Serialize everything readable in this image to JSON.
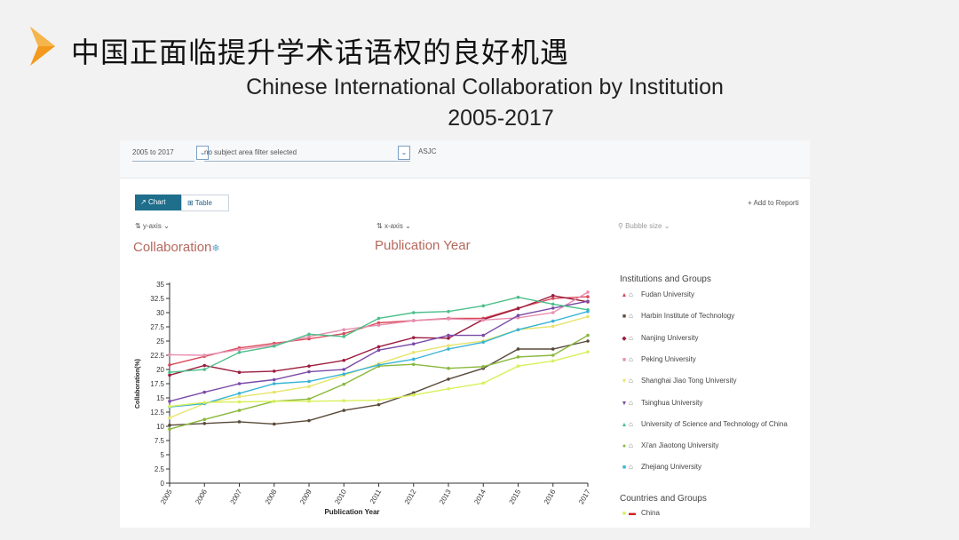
{
  "slide": {
    "title": "中国正面临提升学术话语权的良好机遇",
    "subtitle_line1": "Chinese International Collaboration by Institution",
    "subtitle_line2": "2005-2017",
    "accent_color": "#f39a1e"
  },
  "filters": {
    "year_range": "2005 to 2017",
    "subject": "no subject area filter selected",
    "classification": "ASJC"
  },
  "toolbar": {
    "chart_label": "Chart",
    "table_label": "Table",
    "add_report": "+ Add to Reporti"
  },
  "axes": {
    "y_selector": "y-axis",
    "x_selector": "x-axis",
    "bubble_selector": "Bubble size",
    "y_metric": "Collaboration",
    "x_metric": "Publication Year"
  },
  "legend": {
    "institutions_title": "Institutions and Groups",
    "countries_title": "Countries and Groups",
    "institutions": [
      {
        "name": "Fudan University",
        "color": "#d94a5a",
        "marker": "triangle"
      },
      {
        "name": "Harbin Institute of Technology",
        "color": "#5a4a3a",
        "marker": "square"
      },
      {
        "name": "Nanjing University",
        "color": "#9c1c3c",
        "marker": "diamond"
      },
      {
        "name": "Peking University",
        "color": "#e88fb0",
        "marker": "square"
      },
      {
        "name": "Shanghai Jiao Tong University",
        "color": "#e7e46a",
        "marker": "triangle-down"
      },
      {
        "name": "Tsinghua University",
        "color": "#7a4aa8",
        "marker": "triangle-down"
      },
      {
        "name": "University of Science and Technology of China",
        "color": "#4cbf8a",
        "marker": "triangle"
      },
      {
        "name": "Xi'an Jiaotong University",
        "color": "#8ab83c",
        "marker": "circle"
      },
      {
        "name": "Zhejiang University",
        "color": "#39b3d6",
        "marker": "square"
      }
    ],
    "countries": [
      {
        "name": "China",
        "color": "#d9f05a",
        "flag_color": "#d22020"
      }
    ]
  },
  "chart_data": {
    "type": "line",
    "xlabel": "Publication Year",
    "ylabel": "Collaboration(%)",
    "x": [
      2005,
      2006,
      2007,
      2008,
      2009,
      2010,
      2011,
      2012,
      2013,
      2014,
      2015,
      2016,
      2017
    ],
    "ylim": [
      0,
      35
    ],
    "yticks": [
      0,
      2.5,
      5,
      7.5,
      10,
      12.5,
      15,
      17.5,
      20,
      22.5,
      25,
      27.5,
      30,
      32.5,
      35
    ],
    "grid": false,
    "series": [
      {
        "name": "Fudan University",
        "color": "#d94a5a",
        "values": [
          20.8,
          22.3,
          23.8,
          24.6,
          25.4,
          26.3,
          28.2,
          28.6,
          29.0,
          29.0,
          30.8,
          32.5,
          32.8
        ]
      },
      {
        "name": "Harbin Institute of Technology",
        "color": "#5a4a3a",
        "values": [
          10.2,
          10.5,
          10.8,
          10.4,
          11.0,
          12.8,
          13.8,
          15.9,
          18.3,
          20.2,
          23.6,
          23.6,
          25.0
        ]
      },
      {
        "name": "Nanjing University",
        "color": "#9c1c3c",
        "values": [
          19.0,
          20.7,
          19.5,
          19.7,
          20.6,
          21.6,
          24.0,
          25.6,
          25.5,
          28.8,
          30.7,
          33.0,
          31.9
        ]
      },
      {
        "name": "Peking University",
        "color": "#e88fb0",
        "values": [
          22.6,
          22.5,
          23.5,
          24.3,
          25.8,
          27.0,
          27.8,
          28.6,
          28.9,
          28.7,
          29.1,
          30.0,
          33.6
        ]
      },
      {
        "name": "Shanghai Jiao Tong University",
        "color": "#e7e46a",
        "values": [
          11.5,
          14.0,
          15.2,
          16.0,
          17.0,
          19.0,
          21.0,
          23.0,
          24.2,
          25.0,
          27.0,
          27.6,
          29.3
        ]
      },
      {
        "name": "Tsinghua University",
        "color": "#7a4aa8",
        "values": [
          14.4,
          16.0,
          17.5,
          18.2,
          19.6,
          20.0,
          23.4,
          24.5,
          26.0,
          26.0,
          29.5,
          30.8,
          32.0
        ]
      },
      {
        "name": "University of Science and Technology of China",
        "color": "#4cbf8a",
        "values": [
          19.5,
          20.0,
          23.0,
          24.1,
          26.2,
          25.8,
          29.0,
          30.0,
          30.2,
          31.2,
          32.7,
          31.5,
          30.5
        ]
      },
      {
        "name": "Xi'an Jiaotong University",
        "color": "#8ab83c",
        "values": [
          9.5,
          11.2,
          12.8,
          14.4,
          14.8,
          17.4,
          20.6,
          20.9,
          20.2,
          20.5,
          22.2,
          22.5,
          26.0
        ]
      },
      {
        "name": "Zhejiang University",
        "color": "#39b3d6",
        "values": [
          13.4,
          14.0,
          15.8,
          17.5,
          17.9,
          19.2,
          20.8,
          21.8,
          23.6,
          24.8,
          27.0,
          28.5,
          30.2
        ]
      },
      {
        "name": "China",
        "color": "#d9f05a",
        "values": [
          13.5,
          14.2,
          14.3,
          14.4,
          14.4,
          14.5,
          14.6,
          15.5,
          16.6,
          17.6,
          20.6,
          21.5,
          23.1
        ]
      }
    ]
  }
}
